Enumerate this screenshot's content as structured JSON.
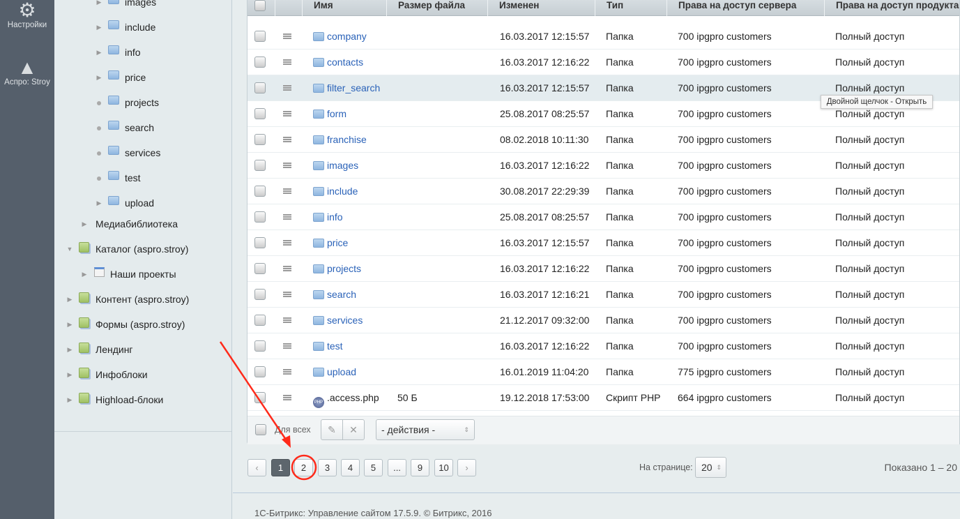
{
  "leftbar": {
    "items": [
      {
        "label": "Настройки",
        "icon": "gear-icon"
      },
      {
        "label": "Аспро: Stroy",
        "icon": "aspro-logo-icon"
      }
    ]
  },
  "tree": {
    "folders": [
      {
        "label": "images",
        "marker": "arrow"
      },
      {
        "label": "include",
        "marker": "arrow"
      },
      {
        "label": "info",
        "marker": "arrow"
      },
      {
        "label": "price",
        "marker": "arrow"
      },
      {
        "label": "projects",
        "marker": "dot"
      },
      {
        "label": "search",
        "marker": "dot"
      },
      {
        "label": "services",
        "marker": "dot"
      },
      {
        "label": "test",
        "marker": "dot"
      },
      {
        "label": "upload",
        "marker": "arrow"
      }
    ],
    "media": "Медиабиблиотека",
    "catalog": "Каталог (aspro.stroy)",
    "catalog_child": "Наши проекты",
    "modules": [
      "Контент (aspro.stroy)",
      "Формы (aspro.stroy)",
      "Лендинг",
      "Инфоблоки",
      "Highload-блоки"
    ]
  },
  "table": {
    "headers": [
      "Имя",
      "Размер файла",
      "Изменен",
      "Тип",
      "Права на доступ сервера",
      "Права на доступ продукта"
    ],
    "rows": [
      [
        "company",
        "",
        "16.03.2017 12:15:57",
        "Папка",
        "700 ipgpro customers",
        "Полный доступ"
      ],
      [
        "contacts",
        "",
        "16.03.2017 12:16:22",
        "Папка",
        "700 ipgpro customers",
        "Полный доступ"
      ],
      [
        "filter_search",
        "",
        "16.03.2017 12:15:57",
        "Папка",
        "700 ipgpro customers",
        "Полный доступ"
      ],
      [
        "form",
        "",
        "25.08.2017 08:25:57",
        "Папка",
        "700 ipgpro customers",
        "Полный доступ"
      ],
      [
        "franchise",
        "",
        "08.02.2018 10:11:30",
        "Папка",
        "700 ipgpro customers",
        "Полный доступ"
      ],
      [
        "images",
        "",
        "16.03.2017 12:16:22",
        "Папка",
        "700 ipgpro customers",
        "Полный доступ"
      ],
      [
        "include",
        "",
        "30.08.2017 22:29:39",
        "Папка",
        "700 ipgpro customers",
        "Полный доступ"
      ],
      [
        "info",
        "",
        "25.08.2017 08:25:57",
        "Папка",
        "700 ipgpro customers",
        "Полный доступ"
      ],
      [
        "price",
        "",
        "16.03.2017 12:15:57",
        "Папка",
        "700 ipgpro customers",
        "Полный доступ"
      ],
      [
        "projects",
        "",
        "16.03.2017 12:16:22",
        "Папка",
        "700 ipgpro customers",
        "Полный доступ"
      ],
      [
        "search",
        "",
        "16.03.2017 12:16:21",
        "Папка",
        "700 ipgpro customers",
        "Полный доступ"
      ],
      [
        "services",
        "",
        "21.12.2017 09:32:00",
        "Папка",
        "700 ipgpro customers",
        "Полный доступ"
      ],
      [
        "test",
        "",
        "16.03.2017 12:16:22",
        "Папка",
        "700 ipgpro customers",
        "Полный доступ"
      ],
      [
        "upload",
        "",
        "16.01.2019 11:04:20",
        "Папка",
        "775 ipgpro customers",
        "Полный доступ"
      ],
      [
        ".access.php",
        "50 Б",
        "19.12.2018 17:53:00",
        "Скрипт PHP",
        "664 ipgpro customers",
        "Полный доступ"
      ]
    ],
    "hover_row": 2,
    "tooltip": "Двойной щелчок - Открыть"
  },
  "actions": {
    "for_all": "Для всех",
    "select": "- действия -"
  },
  "pagination": {
    "pages": [
      "1",
      "2",
      "3",
      "4",
      "5",
      "...",
      "9",
      "10"
    ],
    "current": "1",
    "per_page_label": "На странице:",
    "per_page": "20",
    "shown": "Показано 1 – 20"
  },
  "footer": "1С-Битрикс: Управление сайтом 17.5.9. © Битрикс, 2016",
  "annotation_color": "#ff2a1a"
}
